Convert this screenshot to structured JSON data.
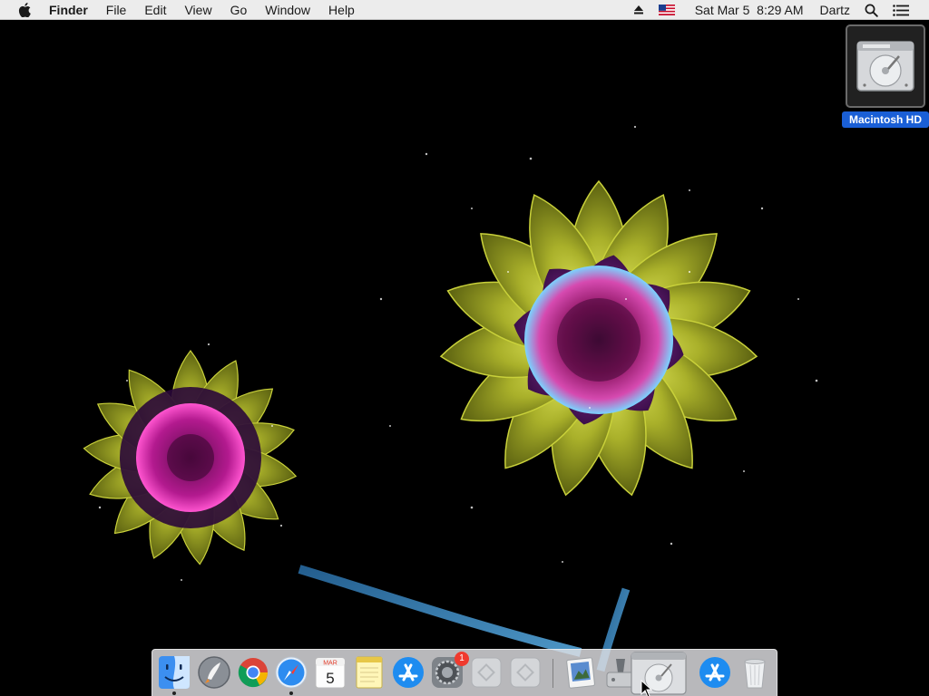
{
  "menubar": {
    "app_name": "Finder",
    "menus": [
      "File",
      "Edit",
      "View",
      "Go",
      "Window",
      "Help"
    ],
    "datetime": "Sat Mar 5  8:29 AM",
    "user": "Dartz"
  },
  "desktop": {
    "icons": [
      {
        "label": "Macintosh HD",
        "icon": "hard-drive-icon",
        "selected": true
      }
    ]
  },
  "dock": {
    "items": [
      {
        "name": "Finder",
        "icon": "finder-icon",
        "running": true
      },
      {
        "name": "Launchpad",
        "icon": "launchpad-icon",
        "running": false
      },
      {
        "name": "Google Chrome",
        "icon": "chrome-icon",
        "running": false
      },
      {
        "name": "Safari",
        "icon": "safari-icon",
        "running": true
      },
      {
        "name": "Calendar",
        "icon": "calendar-icon",
        "running": false,
        "month": "MAR",
        "day": "5"
      },
      {
        "name": "Notes",
        "icon": "notes-icon",
        "running": false
      },
      {
        "name": "App Store",
        "icon": "app-store-icon",
        "running": false
      },
      {
        "name": "System Preferences",
        "icon": "system-preferences-icon",
        "running": false,
        "badge": "1"
      },
      {
        "name": "Generic App",
        "icon": "generic-app-icon",
        "running": false
      },
      {
        "name": "Generic App",
        "icon": "generic-app-icon",
        "running": false
      },
      {
        "name": "Preview",
        "icon": "preview-icon",
        "running": false
      },
      {
        "name": "Disk Utility",
        "icon": "disk-utility-icon",
        "running": false
      },
      {
        "name": "Macintosh HD",
        "icon": "hard-drive-icon",
        "running": false
      },
      {
        "name": "App Store Downloads",
        "icon": "app-store-icon",
        "running": false
      },
      {
        "name": "Trash",
        "icon": "trash-icon",
        "running": false
      }
    ]
  },
  "colors": {
    "menubar_bg": "#ececec",
    "selection_blue": "#1a5fd6",
    "badge_red": "#f03a2e"
  }
}
